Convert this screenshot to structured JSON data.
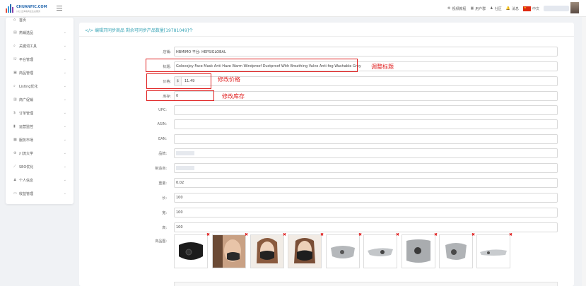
{
  "header": {
    "logo_text": "CHUANFIC.COM",
    "logo_sub": "川社·出海电商全生态服务",
    "nav": [
      {
        "label": "视频教程",
        "icon": "settings-icon"
      },
      {
        "label": "用户群",
        "icon": "grid-icon"
      },
      {
        "label": "社区",
        "icon": "user-icon"
      },
      {
        "label": "消息",
        "icon": "bell-icon"
      },
      {
        "label": "中文",
        "icon": "flag-icon"
      }
    ]
  },
  "sidebar": {
    "items": [
      {
        "label": "首页",
        "icon": "home-icon"
      },
      {
        "label": "热销选品",
        "icon": "cart-icon"
      },
      {
        "label": "关键词工具",
        "icon": "search-icon"
      },
      {
        "label": "平台管理",
        "icon": "shop-icon"
      },
      {
        "label": "商品管理",
        "icon": "box-icon"
      },
      {
        "label": "Listing优化",
        "icon": "magnify-icon"
      },
      {
        "label": "商广促销",
        "icon": "ad-icon"
      },
      {
        "label": "订单管理",
        "icon": "dollar-icon"
      },
      {
        "label": "运营监控",
        "icon": "chart-icon"
      },
      {
        "label": "服务市场",
        "icon": "store-icon"
      },
      {
        "label": "川流大学",
        "icon": "globe-icon"
      },
      {
        "label": "SEO优化",
        "icon": "seo-icon"
      },
      {
        "label": "个人信息",
        "icon": "person-icon"
      },
      {
        "label": "收益管理",
        "icon": "wallet-icon"
      }
    ]
  },
  "main": {
    "title": "编辑开同步商品 剩余可同步产品数量[19781049]个",
    "fields": {
      "store": {
        "label": "店铺:",
        "value": "HBMIMO 平台: HEPSIGLOBAL"
      },
      "title": {
        "label": "标题:",
        "value": "Golovejoy Face Mask Anti Haze Warm Windproof Dustproof With Breathing Valve Anti-fog Washable Grey"
      },
      "price": {
        "label": "价格:",
        "prefix": "$",
        "value": "11.49"
      },
      "stock": {
        "label": "库存:",
        "value": "0"
      },
      "upc": {
        "label": "UPC:",
        "value": ""
      },
      "asin": {
        "label": "ASIN:",
        "value": ""
      },
      "ean": {
        "label": "EAN:",
        "value": ""
      },
      "brand": {
        "label": "品牌:",
        "value": ""
      },
      "manufacturer": {
        "label": "制造商:",
        "value": ""
      },
      "weight": {
        "label": "重量:",
        "value": "0.02"
      },
      "length": {
        "label": "长:",
        "value": "100"
      },
      "width": {
        "label": "宽:",
        "value": "100"
      },
      "height": {
        "label": "高:",
        "value": "100"
      },
      "images": {
        "label": "商品图:"
      }
    },
    "annotations": {
      "title": "调整标题",
      "price": "修改价格",
      "stock": "修改库存"
    }
  },
  "colors": {
    "accent": "#3aa5b7",
    "annotation": "#e02020"
  }
}
